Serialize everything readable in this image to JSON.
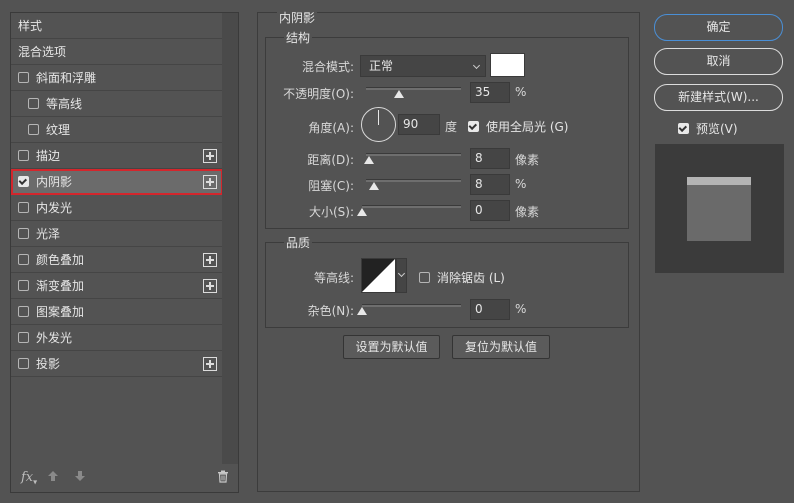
{
  "styles_panel": {
    "items": [
      {
        "label": "样式",
        "checkbox": false,
        "checked": false,
        "plus": false,
        "selected": false,
        "indent": false
      },
      {
        "label": "混合选项",
        "checkbox": false,
        "checked": false,
        "plus": false,
        "selected": false,
        "indent": false
      },
      {
        "label": "斜面和浮雕",
        "checkbox": true,
        "checked": false,
        "plus": false,
        "selected": false,
        "indent": false
      },
      {
        "label": "等高线",
        "checkbox": true,
        "checked": false,
        "plus": false,
        "selected": false,
        "indent": true
      },
      {
        "label": "纹理",
        "checkbox": true,
        "checked": false,
        "plus": false,
        "selected": false,
        "indent": true
      },
      {
        "label": "描边",
        "checkbox": true,
        "checked": false,
        "plus": true,
        "selected": false,
        "indent": false
      },
      {
        "label": "内阴影",
        "checkbox": true,
        "checked": true,
        "plus": true,
        "selected": true,
        "indent": false
      },
      {
        "label": "内发光",
        "checkbox": true,
        "checked": false,
        "plus": false,
        "selected": false,
        "indent": false
      },
      {
        "label": "光泽",
        "checkbox": true,
        "checked": false,
        "plus": false,
        "selected": false,
        "indent": false
      },
      {
        "label": "颜色叠加",
        "checkbox": true,
        "checked": false,
        "plus": true,
        "selected": false,
        "indent": false
      },
      {
        "label": "渐变叠加",
        "checkbox": true,
        "checked": false,
        "plus": true,
        "selected": false,
        "indent": false
      },
      {
        "label": "图案叠加",
        "checkbox": true,
        "checked": false,
        "plus": false,
        "selected": false,
        "indent": false
      },
      {
        "label": "外发光",
        "checkbox": true,
        "checked": false,
        "plus": false,
        "selected": false,
        "indent": false
      },
      {
        "label": "投影",
        "checkbox": true,
        "checked": false,
        "plus": true,
        "selected": false,
        "indent": false
      }
    ],
    "footer": {
      "fx_label": "fx",
      "up_icon": "arrow-up-icon",
      "down_icon": "arrow-down-icon",
      "trash_icon": "trash-icon"
    }
  },
  "inner_shadow": {
    "title": "内阴影",
    "structure": {
      "title": "结构",
      "blend_mode_label": "混合模式:",
      "blend_mode_value": "正常",
      "color": "#ffffff",
      "opacity_label": "不透明度(O):",
      "opacity_value": "35",
      "opacity_unit": "%",
      "opacity_fraction": 0.35,
      "angle_label": "角度(A):",
      "angle_value": "90",
      "angle_unit": "度",
      "global_light_label": "使用全局光 (G)",
      "global_light_checked": true,
      "distance_label": "距离(D):",
      "distance_value": "8",
      "distance_unit": "像素",
      "distance_fraction": 0.03,
      "choke_label": "阻塞(C):",
      "choke_value": "8",
      "choke_unit": "%",
      "choke_fraction": 0.08,
      "size_label": "大小(S):",
      "size_value": "0",
      "size_unit": "像素",
      "size_fraction": 0.0
    },
    "quality": {
      "title": "品质",
      "contour_label": "等高线:",
      "antialias_label": "消除锯齿 (L)",
      "antialias_checked": false,
      "noise_label": "杂色(N):",
      "noise_value": "0",
      "noise_unit": "%",
      "noise_fraction": 0.0
    },
    "make_default_label": "设置为默认值",
    "reset_default_label": "复位为默认值"
  },
  "actions": {
    "ok_label": "确定",
    "cancel_label": "取消",
    "new_style_label": "新建样式(W)...",
    "preview_label": "预览(V)",
    "preview_checked": true
  },
  "colors": {
    "background": "#535353",
    "selected_outline": "#d4262c",
    "primary_border": "#4a8fd6",
    "preview_box": "#3b3b3b",
    "preview_swatch": "#6a6a6a"
  }
}
